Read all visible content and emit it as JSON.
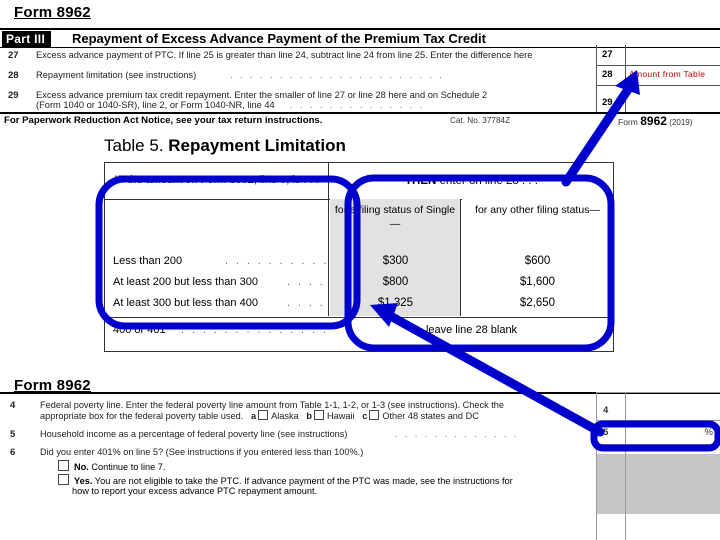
{
  "headings": {
    "top": "Form 8962",
    "bottom": "Form 8962"
  },
  "top_form": {
    "part_tag": "Part III",
    "part_title": "Repayment of Excess Advance Payment of the Premium Tax Credit",
    "lines": [
      {
        "no": "27",
        "text": "Excess advance payment of PTC. If line 25 is greater than line 24, subtract line 24 from line 25. Enter the difference here",
        "text2": ""
      },
      {
        "no": "28",
        "text": "Repayment limitation (see instructions)",
        "leader": ". . . . . . . . . . . . . . . . . . . . . ."
      },
      {
        "no": "29",
        "text": "Excess advance premium tax credit repayment. Enter the smaller of line 27 or line 28 here and on Schedule 2",
        "text2": "(Form 1040 or 1040-SR), line 2, or Form 1040-NR, line 44",
        "leader2": ". . . . . . . . . . . . . ."
      }
    ],
    "amount_cells": [
      {
        "no": "27",
        "note": ""
      },
      {
        "no": "28",
        "note": "Amount from Table"
      },
      {
        "no": "29",
        "note": ""
      }
    ],
    "pra_notice": "For Paperwork Reduction Act Notice, see your tax return instructions.",
    "cat_no": "Cat. No. 37784Z",
    "form_label": "Form",
    "form_number": "8962",
    "form_year": "(2019)"
  },
  "table5": {
    "title_lead": "Table 5.",
    "title_bold": "Repayment Limitation",
    "header_if": "IF the amount on Form 8962, line 5, is . . .",
    "header_if_bold": "IF",
    "header_then_bold": "THEN",
    "header_then_rest": "enter on line 28 . . .",
    "subheader_single": "for a filing status of Single—",
    "subheader_other": "for any other filing status—",
    "rows": [
      {
        "condition": "Less than 200",
        "leader": ". . . . . . . . . .",
        "single": "$300",
        "other": "$600"
      },
      {
        "condition": "At least 200 but less than 300",
        "leader": ". . . .",
        "single": "$800",
        "other": "$1,600"
      },
      {
        "condition": "At least 300 but less than 400",
        "leader": ". . . .",
        "single": "$1,325",
        "other": "$2,650"
      }
    ],
    "final_row": {
      "condition": "400 or 401",
      "leader": ". . . . . . . . . . . . . .",
      "result": "leave line 28 blank"
    }
  },
  "bottom_form": {
    "lines": [
      {
        "no": "4",
        "text": "Federal poverty line. Enter the federal poverty line amount from Table 1-1, 1-2, or 1-3 (see instructions). Check the",
        "text2_prefix": "appropriate box for the federal poverty table used.",
        "options": [
          {
            "letter": "a",
            "label": "Alaska"
          },
          {
            "letter": "b",
            "label": "Hawaii"
          },
          {
            "letter": "c",
            "label": "Other 48 states and DC"
          }
        ]
      },
      {
        "no": "5",
        "text": "Household income as a percentage of federal poverty line (see instructions)",
        "leader": ". . . . . . . . . . . . ."
      },
      {
        "no": "6",
        "text": "Did you enter 401% on line 5? (See instructions if you entered less than 100%.)"
      }
    ],
    "checkboxes": [
      {
        "bold": "No.",
        "text": "Continue to line 7."
      },
      {
        "bold": "Yes.",
        "text": "You are not eligible to take the PTC. If advance payment of the PTC was made, see the instructions for",
        "text2": "how to report your excess advance PTC repayment amount."
      }
    ],
    "right_cells": [
      {
        "no": "4",
        "suffix": ""
      },
      {
        "no": "5",
        "suffix": "%"
      }
    ]
  },
  "annotations": {
    "accent_color": "#0000CC",
    "note_color": "#c00000",
    "callout_if_label": "highlight-if-column",
    "callout_then_label": "highlight-then-column",
    "arrow_upper_label": "arrow-to-line-28",
    "arrow_lower_label": "arrow-to-line-5"
  }
}
